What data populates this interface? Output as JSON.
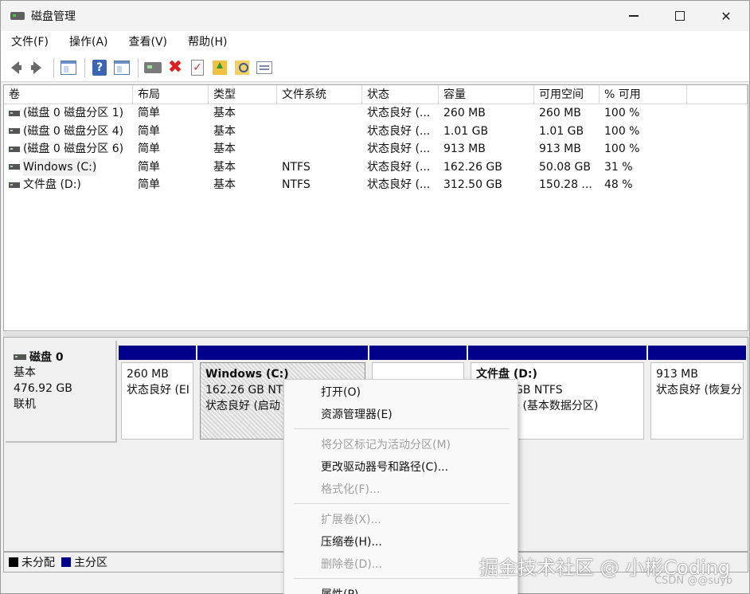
{
  "window": {
    "title": "磁盘管理"
  },
  "menu": [
    "文件(F)",
    "操作(A)",
    "查看(V)",
    "帮助(H)"
  ],
  "toolbar": {
    "icons": [
      "back-arrow-icon",
      "forward-arrow-icon",
      "console-tree-icon",
      "help-icon",
      "show-hide-icon",
      "connect-drive-icon",
      "delete-icon",
      "check-icon",
      "folder-up-icon",
      "search-icon",
      "properties-icon"
    ]
  },
  "list": {
    "columns": [
      "卷",
      "布局",
      "类型",
      "文件系统",
      "状态",
      "容量",
      "可用空间",
      "% 可用",
      ""
    ],
    "rows": [
      [
        "(磁盘 0 磁盘分区 1)",
        "简单",
        "基本",
        "",
        "状态良好 (...",
        "260 MB",
        "260 MB",
        "100 %"
      ],
      [
        "(磁盘 0 磁盘分区 4)",
        "简单",
        "基本",
        "",
        "状态良好 (...",
        "1.01 GB",
        "1.01 GB",
        "100 %"
      ],
      [
        "(磁盘 0 磁盘分区 6)",
        "简单",
        "基本",
        "",
        "状态良好 (...",
        "913 MB",
        "913 MB",
        "100 %"
      ],
      [
        "Windows  (C:)",
        "简单",
        "基本",
        "NTFS",
        "状态良好 (...",
        "162.26 GB",
        "50.08 GB",
        "31 %"
      ],
      [
        "文件盘 (D:)",
        "简单",
        "基本",
        "NTFS",
        "状态良好 (...",
        "312.50 GB",
        "150.28 ...",
        "48 %"
      ]
    ]
  },
  "disk": {
    "name": "磁盘 0",
    "type": "基本",
    "size": "476.92 GB",
    "status": "联机",
    "partitions": [
      {
        "title": "",
        "line1": "260 MB",
        "line2": "状态良好 (EI"
      },
      {
        "title": "Windows   (C:)",
        "line1": "162.26 GB NT",
        "line2": "状态良好 (启动"
      },
      {
        "title": "",
        "line1": "",
        "line2": ""
      },
      {
        "title": "文件盘  (D:)",
        "line1": "GB NTFS",
        "line2": "子 (基本数据分区)"
      },
      {
        "title": "",
        "line1": "913 MB",
        "line2": "状态良好 (恢复分"
      }
    ]
  },
  "legend": [
    {
      "label": "未分配",
      "color": "#000000"
    },
    {
      "label": "主分区",
      "color": "#00008b"
    }
  ],
  "context_menu": {
    "items": [
      {
        "label": "打开(O)",
        "enabled": true
      },
      {
        "label": "资源管理器(E)",
        "enabled": true
      },
      {
        "label": "将分区标记为活动分区(M)",
        "enabled": false
      },
      {
        "label": "更改驱动器号和路径(C)...",
        "enabled": true
      },
      {
        "label": "格式化(F)...",
        "enabled": false
      },
      {
        "label": "扩展卷(X)...",
        "enabled": false
      },
      {
        "label": "压缩卷(H)...",
        "enabled": true
      },
      {
        "label": "删除卷(D)...",
        "enabled": false
      },
      {
        "label": "属性(P)",
        "enabled": true
      }
    ]
  },
  "watermark": {
    "text": "掘金技术社区 @ 小彬Coding",
    "csdn": "CSDN @@suyb"
  }
}
